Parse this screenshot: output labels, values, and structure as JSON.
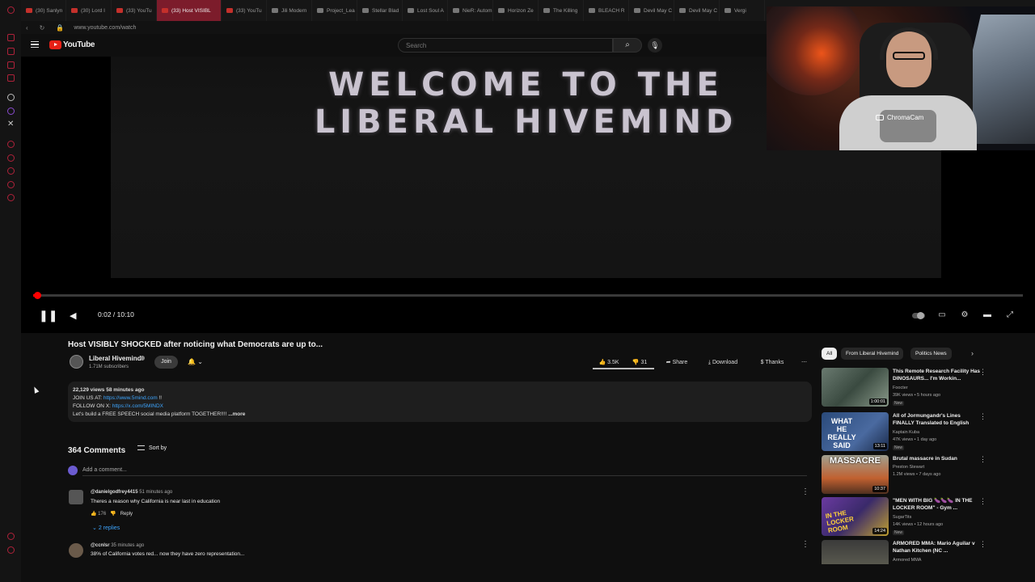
{
  "browser": {
    "tabs": [
      {
        "label": "(30) Sanlyn"
      },
      {
        "label": "(30) Lord I"
      },
      {
        "label": "(33) YouTu"
      },
      {
        "label": "(33) Host VISIBL",
        "active": true
      },
      {
        "label": "(33) YouTu"
      },
      {
        "label": "Jili Modern"
      },
      {
        "label": "Project_Lea"
      },
      {
        "label": "Stellar Blad"
      },
      {
        "label": "Lost Soul A"
      },
      {
        "label": "NieR: Autom"
      },
      {
        "label": "Horizon Ze"
      },
      {
        "label": "The Killing"
      },
      {
        "label": "BLEACH R"
      },
      {
        "label": "Devil May C"
      },
      {
        "label": "Devil May C"
      },
      {
        "label": "Vergi"
      }
    ],
    "url": "www.youtube.com/watch"
  },
  "youtube": {
    "logo_text": "YouTube",
    "search_placeholder": "Search",
    "search_icon": "search-icon",
    "mic_icon": "microphone-icon"
  },
  "player": {
    "overlay_line1": "WELCOME TO THE",
    "overlay_line2": "LIBERAL HIVEMIND",
    "time": "0:02 / 10:10",
    "progress_fraction": 0.0033
  },
  "webcam": {
    "label": "ChromaCam"
  },
  "video": {
    "title": "Host VISIBLY SHOCKED after noticing what Democrats are up to...",
    "channel": "Liberal Hivemind",
    "subscribers": "1.71M subscribers",
    "join_label": "Join",
    "likes": "3.5K",
    "dislikes": "31",
    "share_label": "Share",
    "download_label": "Download",
    "thanks_label": "Thanks"
  },
  "description": {
    "meta": "22,129 views  58 minutes ago",
    "line1_prefix": "JOIN US AT: ",
    "line1_link": "https://www.5mind.com",
    "line1_suffix": " !!",
    "line2_prefix": "FOLLOW ON X: ",
    "line2_link": "https://x.com/5MINDX",
    "line3": "Let's build a FREE SPEECH social media platform TOGETHER!!!! ",
    "more": "...more"
  },
  "comments": {
    "count": "364 Comments",
    "sort_label": "Sort by",
    "add_placeholder": "Add a comment...",
    "items": [
      {
        "user": "@danielgodfrey4415",
        "time": "51 minutes ago",
        "text": "Theres a reason why California is near last in education",
        "likes": "176",
        "reply": "Reply",
        "replies": "2 replies"
      },
      {
        "user": "@ccnlsr",
        "time": "35 minutes ago",
        "text": "38% of California votes red... now they have zero representation..."
      }
    ]
  },
  "sidebar": {
    "chips": [
      "All",
      "From Liberal Hivemind",
      "Politics News"
    ],
    "recommendations": [
      {
        "title": "This Remote Research Facility Has DINOSAURS... I'm Workin...",
        "channel": "Foocter",
        "views": "39K views • 5 hours ago",
        "badge": "New",
        "duration": "1:00:01"
      },
      {
        "title": "All of Jormungandr's Lines FINALLY Translated to English",
        "channel": "Kaptain Kuba",
        "views": "47K views • 1 day ago",
        "badge": "New",
        "duration": "13:11",
        "thumb_text": "WHAT HE REALLY SAID"
      },
      {
        "title": "Brutal massacre in Sudan",
        "channel": "Preston Stewart",
        "views": "1.2M views • 7 days ago",
        "badge": "",
        "duration": "10:37",
        "thumb_text": "MASSACRE"
      },
      {
        "title": "\"MEN WITH BIG 🍆🍆🍆 IN THE LOCKER ROOM\" - Gym ...",
        "channel": "SugarTits",
        "views": "14K views • 12 hours ago",
        "badge": "New",
        "duration": "14:24",
        "thumb_text": "IN THE LOCKER ROOM"
      },
      {
        "title": "ARMORED MMA: Mario Aguilar v Nathan Kitchen (NC ...",
        "channel": "Armored MMA",
        "views": "",
        "badge": "",
        "duration": ""
      }
    ]
  }
}
